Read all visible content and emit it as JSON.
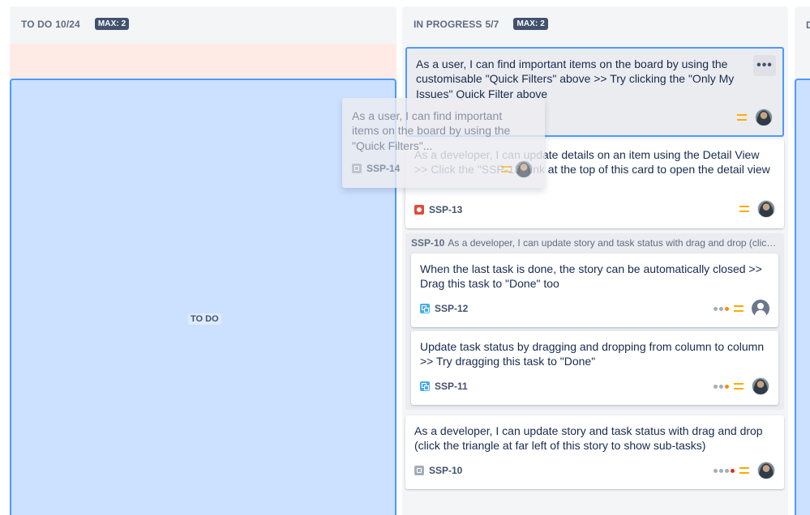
{
  "columns": {
    "todo": {
      "title": "TO DO",
      "count": "10/24",
      "max": "MAX: 2",
      "drop_label": "TO DO"
    },
    "in_progress": {
      "title": "IN PROGRESS",
      "count": "5/7",
      "max": "MAX: 2"
    },
    "done": {
      "letter": "D"
    }
  },
  "cards": [
    {
      "text": "As a user, I can find important items on the board by using the customisable \"Quick Filters\" above >> Try clicking the \"Only My Issues\" Quick Filter above",
      "key": "SSP-14",
      "type": "story-icon",
      "priority": "medium"
    },
    {
      "text": "As a developer, I can update details on an item using the Detail View >> Click the \"SSP-13\" link at the top of this card to open the detail view",
      "key": "SSP-13",
      "type": "bug-icon",
      "priority": "medium"
    },
    {
      "text": "When the last task is done, the story can be automatically closed >> Drag this task to \"Done\" too",
      "key": "SSP-12",
      "type": "subtask-icon",
      "priority": "medium"
    },
    {
      "text": "Update task status by dragging and dropping from column to column >> Try dragging this task to \"Done\"",
      "key": "SSP-11",
      "type": "subtask-icon",
      "priority": "medium"
    },
    {
      "text": "As a developer, I can update story and task status with drag and drop (click the triangle at far left of this story to show sub-tasks)",
      "key": "SSP-10",
      "type": "story-icon",
      "priority": "medium"
    }
  ],
  "swimlane": {
    "key": "SSP-10",
    "summary": "As a developer, I can update story and task status with drag and drop (click the triangle at far left of this story to show sub-tasks)"
  },
  "more_actions": "•••",
  "drag_ghost": {
    "text": "As a user, I can find important items on the board by using the \"Quick Filters\"...",
    "key": "SSP-14"
  },
  "colors": {
    "column_bg": "#f4f5f7",
    "drop_zone": "#cce0ff",
    "drop_border": "#4c9aff",
    "limit_exceeded": "#ffebe6",
    "priority_medium": "#ffab00"
  }
}
